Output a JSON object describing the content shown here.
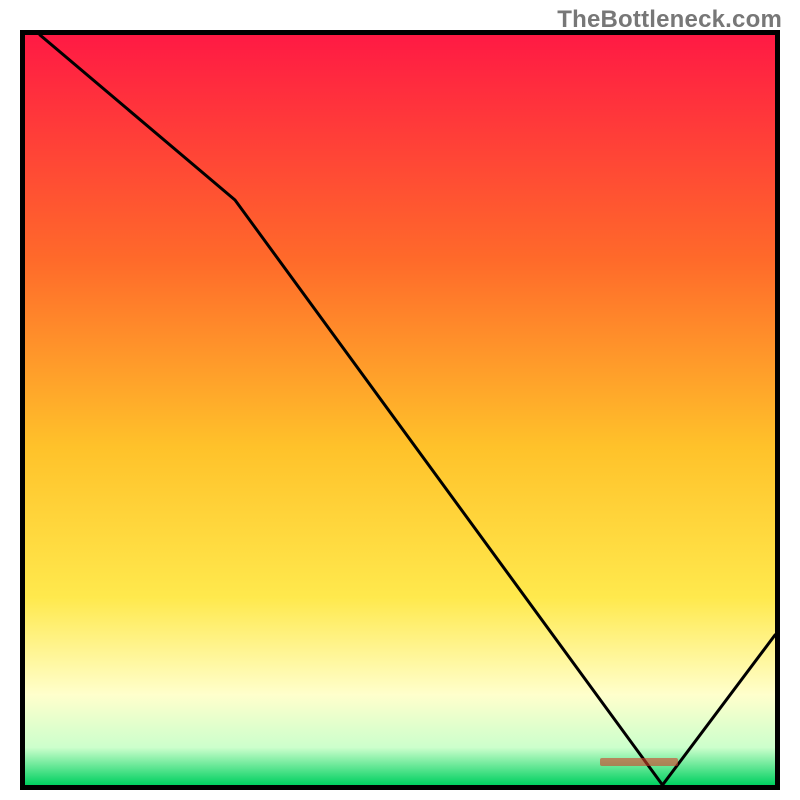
{
  "watermark": {
    "text": "TheBottleneck.com"
  },
  "chart_data": {
    "type": "line",
    "title": "",
    "xlabel": "",
    "ylabel": "",
    "xlim": [
      0,
      100
    ],
    "ylim": [
      0,
      100
    ],
    "grid": false,
    "background_gradient": {
      "stops": [
        {
          "offset": 0.0,
          "color": "#ff1a44"
        },
        {
          "offset": 0.3,
          "color": "#ff6a2a"
        },
        {
          "offset": 0.55,
          "color": "#ffc22a"
        },
        {
          "offset": 0.75,
          "color": "#ffe94d"
        },
        {
          "offset": 0.88,
          "color": "#ffffcc"
        },
        {
          "offset": 0.95,
          "color": "#ccffcc"
        },
        {
          "offset": 1.0,
          "color": "#00d060"
        }
      ]
    },
    "series": [
      {
        "name": "curve",
        "color": "#000000",
        "x": [
          2,
          28,
          85,
          100
        ],
        "y": [
          100,
          78,
          0,
          20
        ],
        "comment": "Piecewise line: steep initial drop, long linear descent to a sharp notch-minimum near x≈85, then rises to the right edge."
      }
    ],
    "annotations": [
      {
        "name": "min-marker",
        "text": "",
        "x": 82,
        "y": 2,
        "color": "#d04028",
        "comment": "Small red horizontal label segment sitting at the bottom near the notch minimum; original text is not legibly resolvable."
      }
    ]
  }
}
